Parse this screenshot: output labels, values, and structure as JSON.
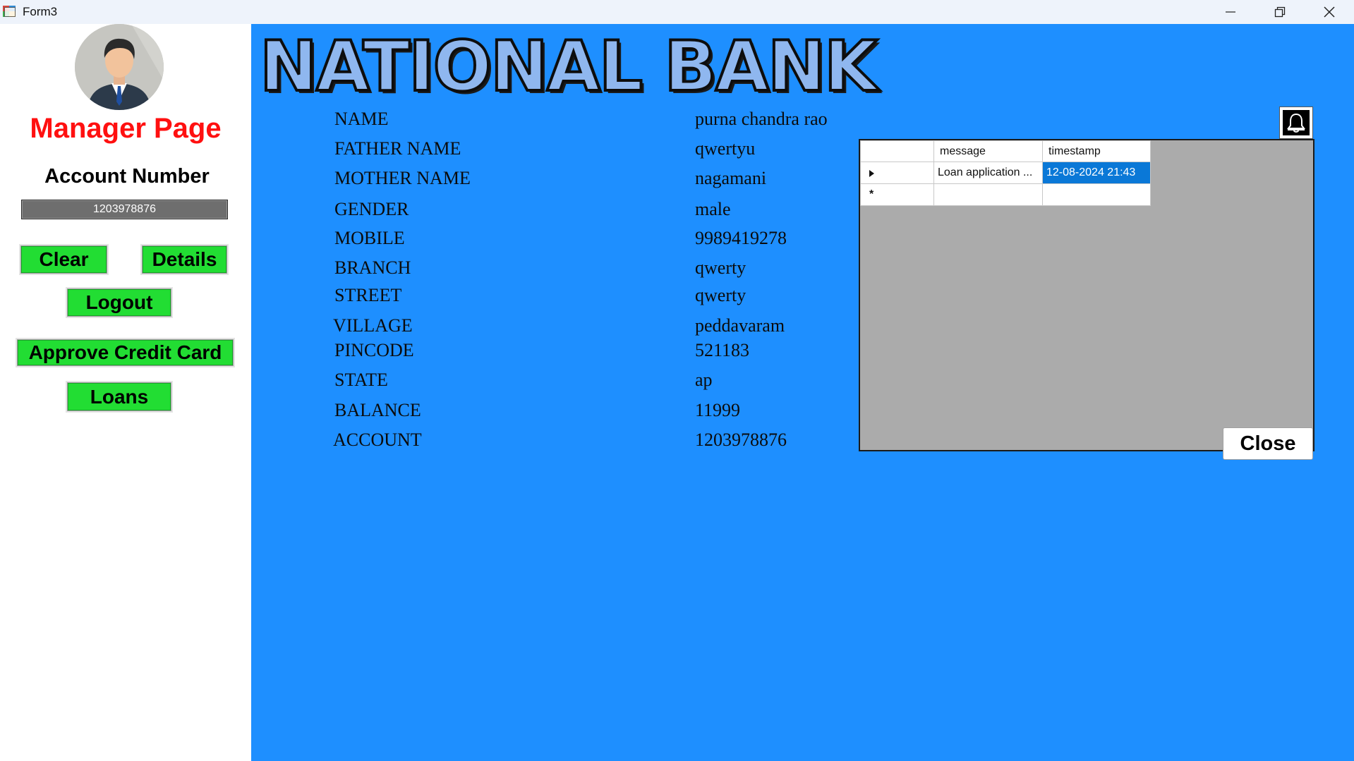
{
  "window": {
    "title": "Form3"
  },
  "sidebar": {
    "heading": "Manager Page",
    "account_label": "Account Number",
    "account_value": "1203978876",
    "buttons": {
      "clear": "Clear",
      "details": "Details",
      "logout": "Logout",
      "approve_credit_card": "Approve Credit Card",
      "loans": "Loans"
    }
  },
  "main": {
    "bank_title": "NATIONAL BANK",
    "details": [
      {
        "label": "NAME",
        "value": "purna chandra rao"
      },
      {
        "label": "FATHER NAME",
        "value": "qwertyu"
      },
      {
        "label": "MOTHER NAME",
        "value": "nagamani"
      },
      {
        "label": "GENDER",
        "value": "male"
      },
      {
        "label": "MOBILE",
        "value": "9989419278"
      },
      {
        "label": "BRANCH",
        "value": "qwerty"
      },
      {
        "label": "STREET",
        "value": "qwerty"
      },
      {
        "label": "VILLAGE",
        "value": "peddavaram"
      },
      {
        "label": "PINCODE",
        "value": "521183"
      },
      {
        "label": "STATE",
        "value": "ap"
      },
      {
        "label": "BALANCE",
        "value": "11999"
      },
      {
        "label": "ACCOUNT",
        "value": "1203978876"
      }
    ],
    "notifications": {
      "columns": [
        "message",
        "timestamp"
      ],
      "rows": [
        {
          "message": "Loan application ...",
          "timestamp": "12-08-2024 21:43"
        }
      ],
      "new_row_marker": "*",
      "close_label": "Close"
    }
  },
  "icons": {
    "bell": "bell-icon",
    "avatar": "manager-avatar",
    "row_pointer": "current-row-pointer-icon"
  },
  "colors": {
    "main_background": "#1e8fff",
    "button_green": "#22dd33",
    "heading_red": "#ff1010",
    "selection_blue": "#0a78d7"
  }
}
